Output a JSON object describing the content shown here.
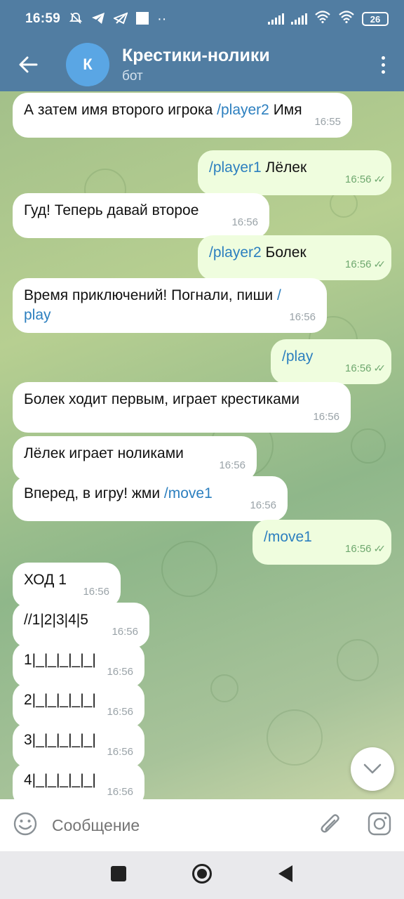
{
  "status_bar": {
    "time": "16:59",
    "battery": "26",
    "icons": [
      "mute-icon",
      "telegram-icon",
      "telegram-x-icon",
      "square-icon",
      "more-icon"
    ]
  },
  "header": {
    "avatar_letter": "К",
    "title": "Крестики-нолики",
    "subtitle": "бот"
  },
  "messages": [
    {
      "dir": "in",
      "parts": [
        {
          "t": "А затем имя второго игрока "
        },
        {
          "t": "/player2",
          "cmd": true
        },
        {
          "t": " Имя"
        }
      ],
      "time": "16:55"
    },
    {
      "dir": "out",
      "parts": [
        {
          "t": "/player1",
          "cmd": true
        },
        {
          "t": " Лёлек"
        }
      ],
      "time": "16:56"
    },
    {
      "dir": "in",
      "parts": [
        {
          "t": "Гуд! Теперь давай второе"
        }
      ],
      "time": "16:56"
    },
    {
      "dir": "out",
      "parts": [
        {
          "t": "/player2",
          "cmd": true
        },
        {
          "t": " Болек"
        }
      ],
      "time": "16:56"
    },
    {
      "dir": "in",
      "parts": [
        {
          "t": "Время приключений! Погнали, пиши "
        },
        {
          "t": "/",
          "cmd": true
        }
      ],
      "line2": "play",
      "time": "16:56"
    },
    {
      "dir": "out",
      "parts": [
        {
          "t": "/play",
          "cmd": true
        }
      ],
      "time": "16:56"
    },
    {
      "dir": "in",
      "parts": [
        {
          "t": "Болек ходит первым, играет крестиками"
        }
      ],
      "time": "16:56"
    },
    {
      "dir": "in",
      "parts": [
        {
          "t": "Лёлек играет ноликами"
        }
      ],
      "time": "16:56"
    },
    {
      "dir": "in",
      "parts": [
        {
          "t": "Вперед, в игру! жми "
        },
        {
          "t": "/move1",
          "cmd": true
        }
      ],
      "time": "16:56"
    },
    {
      "dir": "out",
      "parts": [
        {
          "t": "/move1",
          "cmd": true
        }
      ],
      "time": "16:56"
    },
    {
      "dir": "in",
      "parts": [
        {
          "t": "ХОД 1"
        }
      ],
      "time": "16:56"
    },
    {
      "dir": "in",
      "parts": [
        {
          "t": "//1|2|3|4|5"
        }
      ],
      "time": "16:56"
    },
    {
      "dir": "in",
      "parts": [
        {
          "t": "1|_|_|_|_|_|"
        }
      ],
      "time": "16:56"
    },
    {
      "dir": "in",
      "parts": [
        {
          "t": "2|_|_|_|_|_|"
        }
      ],
      "time": "16:56"
    },
    {
      "dir": "in",
      "parts": [
        {
          "t": "3|_|_|_|_|_|"
        }
      ],
      "time": "16:56"
    },
    {
      "dir": "in",
      "parts": [
        {
          "t": "4|_|_|_|_|_|"
        }
      ],
      "time": "16:56"
    }
  ],
  "composer": {
    "placeholder": "Сообщение"
  }
}
